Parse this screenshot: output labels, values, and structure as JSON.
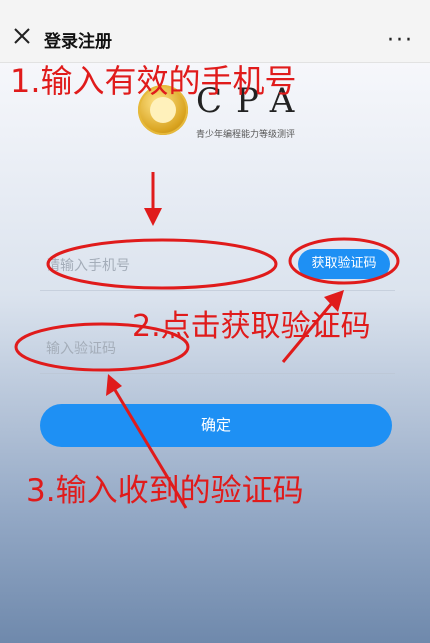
{
  "header": {
    "title": "登录注册",
    "close_icon": "close-icon",
    "more_icon": "more-icon",
    "more_glyph": "···"
  },
  "logo": {
    "text": "CPA",
    "subtext": "青少年编程能力等级测评"
  },
  "form": {
    "phone_placeholder": "请输入手机号",
    "phone_value": "",
    "get_code_label": "获取验证码",
    "code_placeholder": "输入验证码",
    "code_value": "",
    "confirm_label": "确定"
  },
  "annotations": {
    "step1": "1.输入有效的手机号",
    "step2": "2.点击获取验证码",
    "step3": "3.输入收到的验证码"
  },
  "colors": {
    "accent": "#1e90f4",
    "annotation": "#e01b1b"
  }
}
